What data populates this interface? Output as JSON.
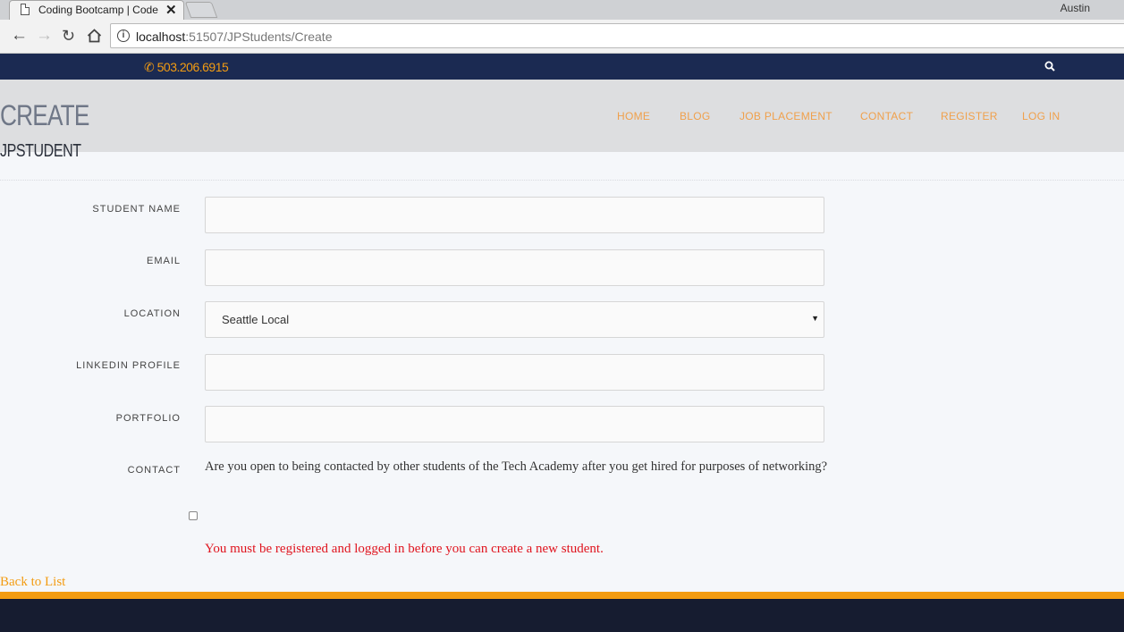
{
  "browser": {
    "tab_title": "Coding Bootcamp | Code",
    "tab_close": "✕",
    "user": "Austin",
    "url_host": "localhost",
    "url_rest": ":51507/JPStudents/Create"
  },
  "topbar": {
    "phone": "503.206.6915",
    "colors": {
      "bar": "#1b2a52",
      "accent": "#f39c12"
    }
  },
  "header": {
    "title": "CREATE",
    "subtitle": "JPSTUDENT",
    "menu": [
      "HOME",
      "BLOG",
      "JOB PLACEMENT",
      "CONTACT",
      "REGISTER",
      "LOG IN"
    ]
  },
  "form": {
    "student_name_label": "STUDENT NAME",
    "student_name_value": "",
    "email_label": "EMAIL",
    "email_value": "",
    "location_label": "LOCATION",
    "location_value": "Seattle Local",
    "linkedin_label": "LINKEDIN PROFILE",
    "linkedin_value": "",
    "portfolio_label": "PORTFOLIO",
    "portfolio_value": "",
    "contact_label": "CONTACT",
    "contact_question": "Are you open to being contacted by other students of the Tech Academy after you get hired for purposes of networking?",
    "contact_checked": false,
    "error_message": "You must be registered and logged in before you can create a new student."
  },
  "back_link": "Back to List"
}
